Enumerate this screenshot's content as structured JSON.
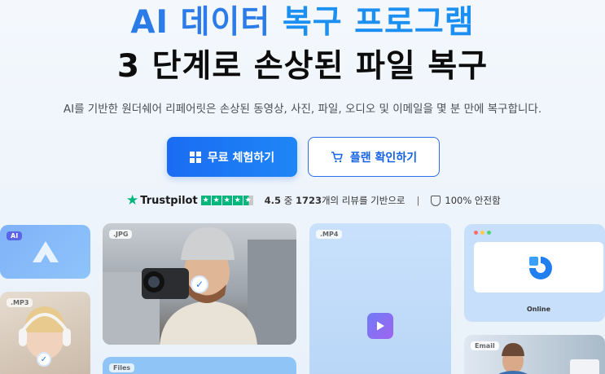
{
  "hero": {
    "title_line1_part1": "AI 데이터",
    "title_line1_part2": "복구 프로그램",
    "title_line2": "3 단계로 손상된 파일 복구",
    "subtitle": "AI를 기반한 원더쉐어 리페어릿은 손상된 동영상, 사진, 파일, 오디오 및 이메일을 몇 분 만에 복구합니다."
  },
  "buttons": {
    "primary_label": "무료 체험하기",
    "secondary_label": "플랜 확인하기"
  },
  "trust": {
    "brand": "Trustpilot",
    "rating": "4.5",
    "rating_mid": "중",
    "review_count": "1723",
    "review_suffix": "개의 리뷰를 기반으로",
    "separator": "|",
    "safety": "100% 안전함"
  },
  "cards": {
    "ai_tag": "AI",
    "mp3_tag": ".MP3",
    "jpg_tag": ".JPG",
    "files_tag": "Files",
    "mp4_tag": ".MP4",
    "online_label": "Online",
    "email_tag": "Email"
  },
  "colors": {
    "accent": "#1f86f7",
    "title_blue": "#2b7be8",
    "trustpilot_green": "#00b67a"
  },
  "icons": {
    "primary_button": "windows-icon",
    "secondary_button": "cart-icon",
    "safety": "shield-check-icon",
    "trust_star": "trustpilot-star-icon"
  }
}
